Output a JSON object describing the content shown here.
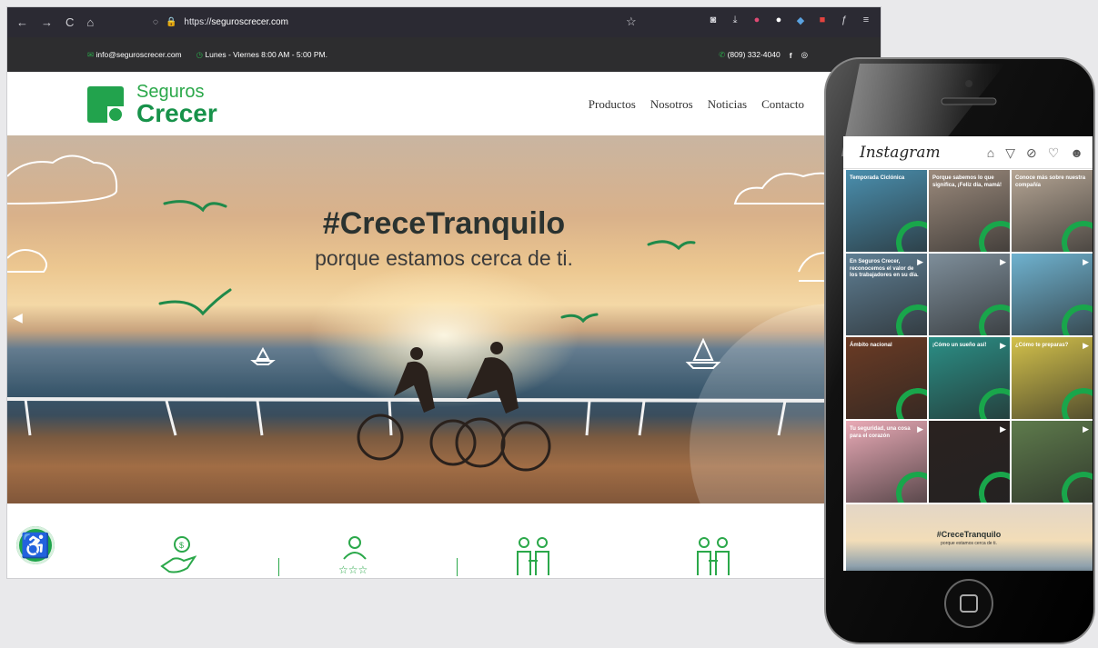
{
  "browser": {
    "url_scheme": "https://",
    "url_host": "seguroscrecer.com",
    "nav": {
      "back": "←",
      "forward": "→",
      "reload": "C",
      "home": "⌂"
    }
  },
  "topbar": {
    "email": "info@seguroscrecer.com",
    "hours": "Lunes - Viernes 8:00 AM - 5:00 PM.",
    "phone": "(809) 332-4040",
    "facebook": "f",
    "instagram": "◎"
  },
  "header": {
    "logo_line1": "Seguros",
    "logo_line2": "Crecer",
    "menu": [
      "Productos",
      "Nosotros",
      "Noticias",
      "Contacto"
    ]
  },
  "hero": {
    "title": "#CreceTranquilo",
    "subtitle": "porque estamos cerca de ti."
  },
  "features": {
    "accessibility_symbol": "♿"
  },
  "instagram": {
    "title": "Instagram",
    "icons": [
      "⌂",
      "▽",
      "⊘",
      "♡",
      "☻"
    ],
    "tiles": [
      {
        "caption": "Temporada Ciclónica",
        "bg": "#4a8fae",
        "play": false
      },
      {
        "caption": "Porque sabemos lo que significa, ¡Feliz día, mamá!",
        "bg": "#9b8a7c",
        "play": false
      },
      {
        "caption": "Conoce más sobre nuestra compañía",
        "bg": "#b5a594",
        "play": false
      },
      {
        "caption": "En Seguros Crecer, reconocemos el valor de los trabajadores en su día.",
        "bg": "#5f7f94",
        "play": true
      },
      {
        "caption": "",
        "bg": "#7e8e9a",
        "play": true
      },
      {
        "caption": "",
        "bg": "#6fb2cf",
        "play": true
      },
      {
        "caption": "Ámbito nacional",
        "bg": "#6b3b24",
        "play": false
      },
      {
        "caption": "¡Cómo un sueño así!",
        "bg": "#2b8f86",
        "play": true
      },
      {
        "caption": "¿Cómo te preparas?",
        "bg": "#d3c14b",
        "play": true
      },
      {
        "caption": "Tu seguridad, una cosa para el corazón",
        "bg": "#e9aab6",
        "play": true
      },
      {
        "caption": "",
        "bg": "#2a2220",
        "play": true
      },
      {
        "caption": "",
        "bg": "#5e7b4c",
        "play": true
      }
    ],
    "big_tile_title": "#CreceTranquilo",
    "big_tile_sub": "porque estamos cerca de ti."
  }
}
